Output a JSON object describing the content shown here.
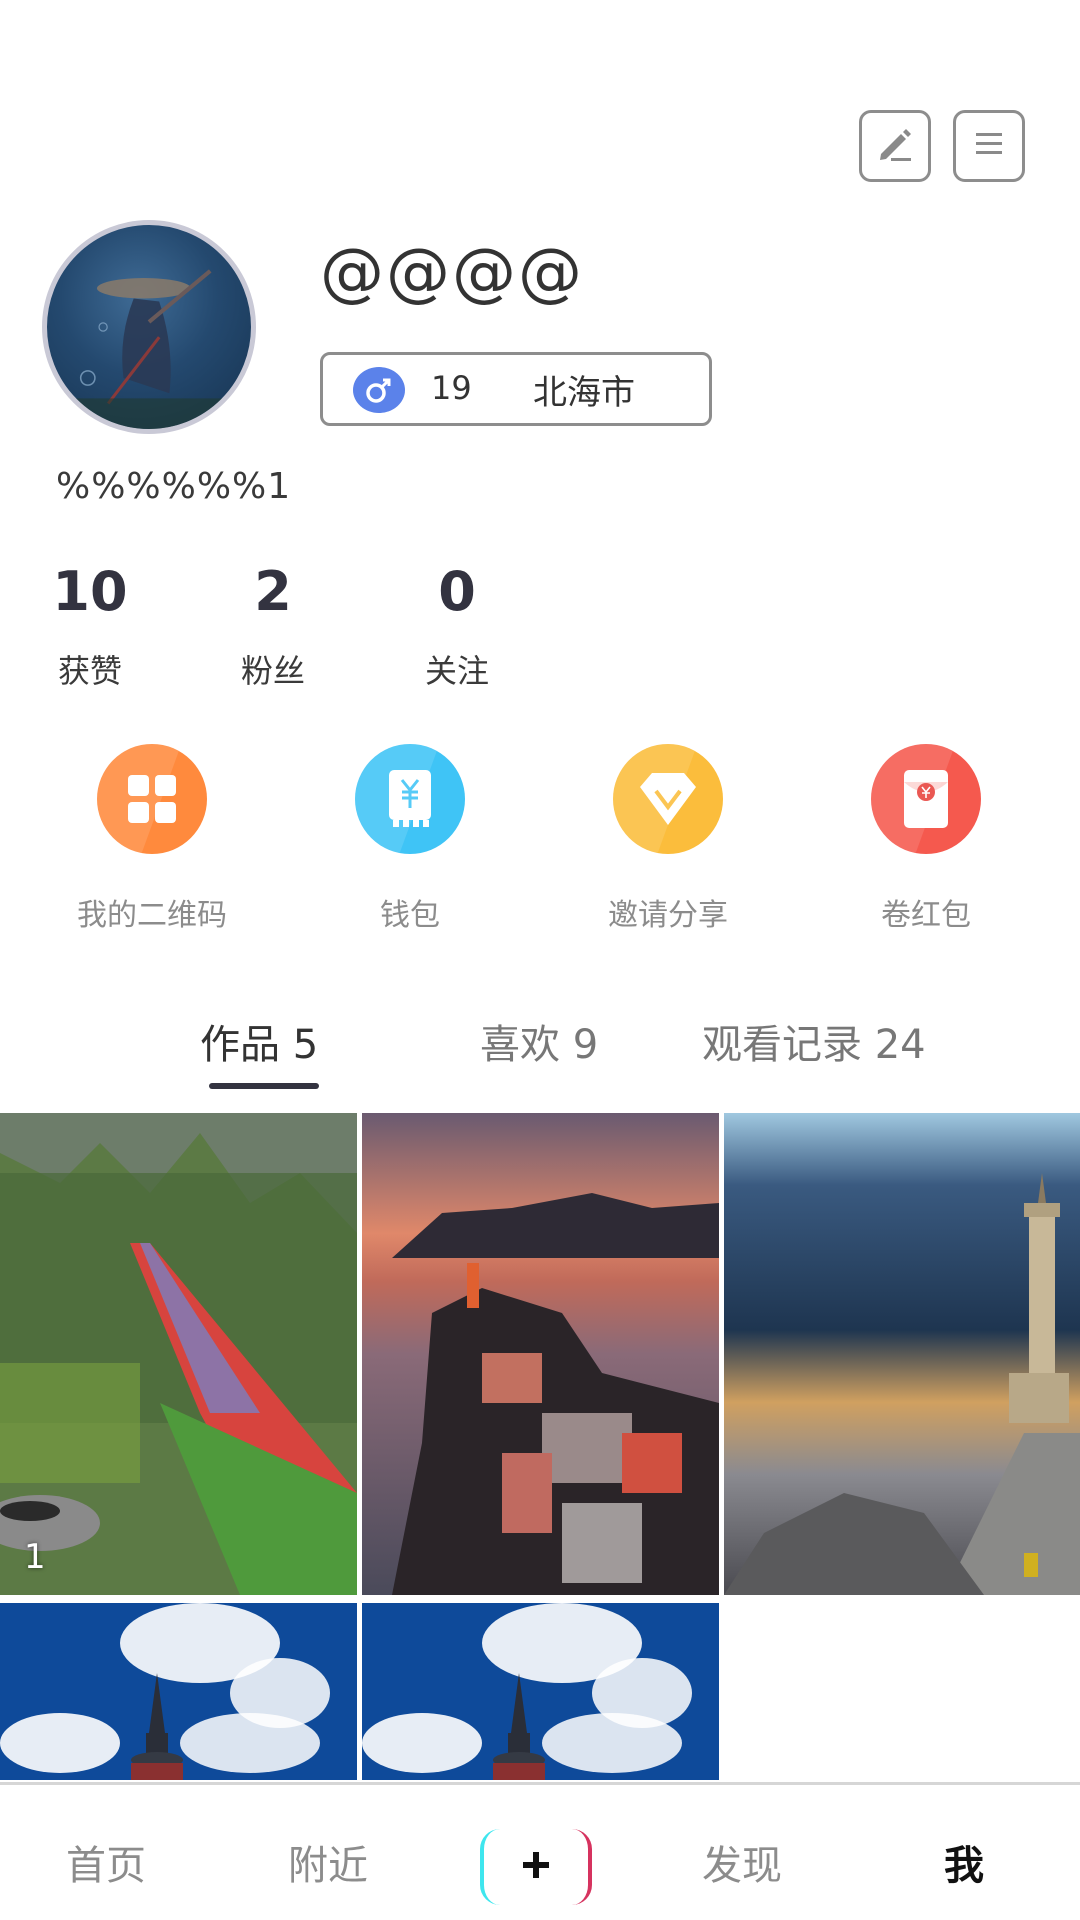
{
  "header": {
    "edit_icon": "pencil-icon",
    "menu_icon": "hamburger-menu-icon"
  },
  "profile": {
    "username": "@@@@",
    "gender": "male",
    "gender_icon": "male-symbol-icon",
    "gender_color": "#5b82ea",
    "age": "19",
    "city": "北海市",
    "signature": "%%%%%%1"
  },
  "stats": [
    {
      "value": "10",
      "label": "获赞"
    },
    {
      "value": "2",
      "label": "粉丝"
    },
    {
      "value": "0",
      "label": "关注"
    }
  ],
  "actions": [
    {
      "label": "我的二维码",
      "icon": "qr-grid-icon",
      "color": "#ff8a3d"
    },
    {
      "label": "钱包",
      "icon": "wallet-yuan-icon",
      "color": "#3fc4f6"
    },
    {
      "label": "邀请分享",
      "icon": "diamond-share-icon",
      "color": "#fbbd3c"
    },
    {
      "label": "卷红包",
      "icon": "red-envelope-icon",
      "color": "#f5594e"
    }
  ],
  "tabs": [
    {
      "label": "作品 5",
      "active": true
    },
    {
      "label": "喜欢 9",
      "active": false
    },
    {
      "label": "观看记录 24",
      "active": false
    }
  ],
  "grid": [
    {
      "subject": "rainbow slide on green hillside",
      "count": "1"
    },
    {
      "subject": "cliffside town at sunset"
    },
    {
      "subject": "lighthouse on foggy pier"
    },
    {
      "subject": "tower under blue sky with clouds"
    },
    {
      "subject": "tower under blue sky with clouds"
    }
  ],
  "bottom_nav": [
    {
      "label": "首页",
      "active": false
    },
    {
      "label": "附近",
      "active": false
    },
    {
      "label": "+",
      "icon": "add-post-icon"
    },
    {
      "label": "发现",
      "active": false
    },
    {
      "label": "我",
      "active": true
    }
  ]
}
